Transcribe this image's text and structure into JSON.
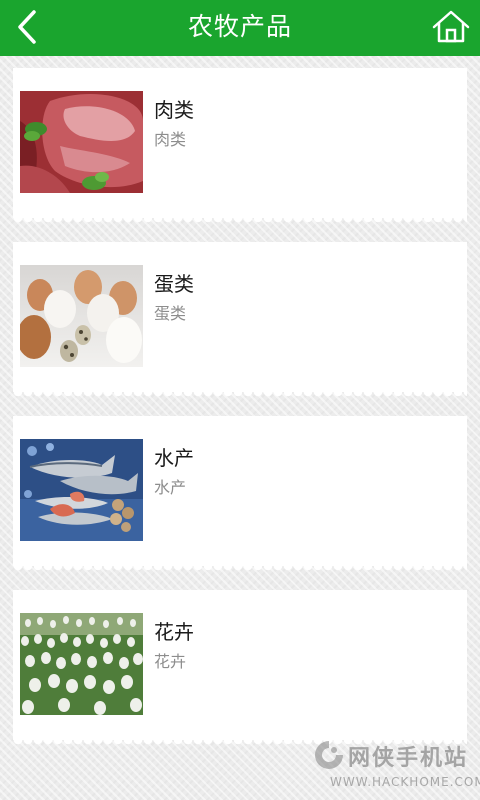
{
  "header": {
    "title": "农牧产品",
    "back_icon": "chevron-left-icon",
    "home_icon": "home-icon",
    "color": "#1aa52e"
  },
  "items": [
    {
      "title": "肉类",
      "subtitle": "肉类",
      "image": "meat-image"
    },
    {
      "title": "蛋类",
      "subtitle": "蛋类",
      "image": "eggs-image"
    },
    {
      "title": "水产",
      "subtitle": "水产",
      "image": "fish-image"
    },
    {
      "title": "花卉",
      "subtitle": "花卉",
      "image": "tulips-image"
    }
  ],
  "watermark": {
    "text": "网侠手机站",
    "url": "WWW.HACKHOME.COM"
  }
}
